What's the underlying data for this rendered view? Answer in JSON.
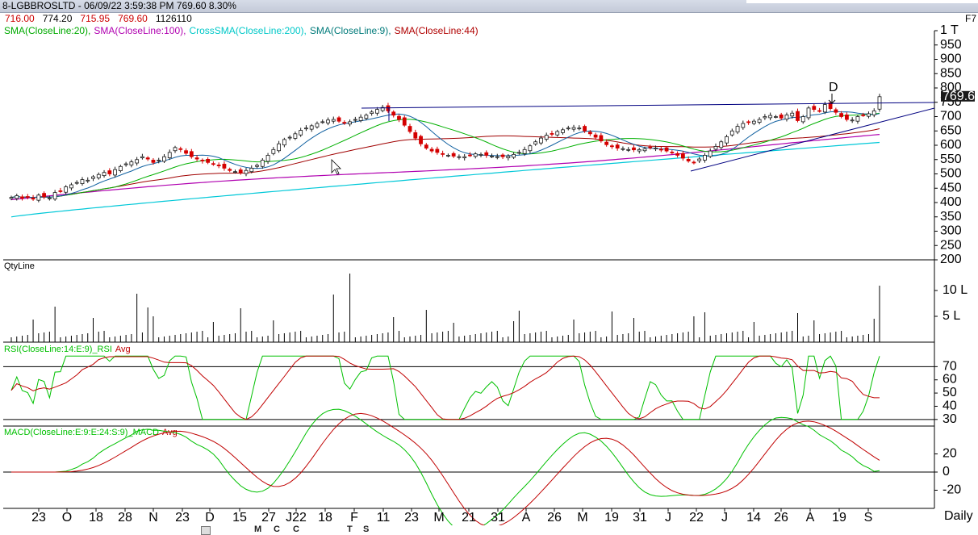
{
  "window": {
    "title": "8-LGBBROSLTD - 06/09/22 3:59:38 PM 769.60 8.30%",
    "shortcut": "F7"
  },
  "ohlc": [
    {
      "text": "716.00",
      "color": "#cc0000"
    },
    {
      "text": "774.20",
      "color": "#000000"
    },
    {
      "text": "715.95",
      "color": "#cc0000"
    },
    {
      "text": "769.60",
      "color": "#cc0000"
    },
    {
      "text": "1126110",
      "color": "#000000"
    }
  ],
  "indicators": [
    {
      "text": "SMA(CloseLine:20),",
      "color": "#00aa00"
    },
    {
      "text": "SMA(CloseLine:100),",
      "color": "#b000b0"
    },
    {
      "text": "CrossSMA(CloseLine:200),",
      "color": "#00c8c8"
    },
    {
      "text": "SMA(CloseLine:9),",
      "color": "#007a7a"
    },
    {
      "text": "SMA(CloseLine:44)",
      "color": "#b00000"
    }
  ],
  "colors": {
    "up": "#1a1a1a",
    "down": "#d40000",
    "sma20": "#00b000",
    "sma100": "#b000b0",
    "sma200": "#00c8d8",
    "sma9": "#1060a0",
    "sma44": "#a00000",
    "trend": "#000080",
    "rsi": "#00c000",
    "rsi_avg": "#c00000",
    "macd": "#00c000",
    "macd_avg": "#c00000",
    "volume": "#000000",
    "price_tag_bg": "#1a1a1a",
    "price_tag_fg": "#ffffff"
  },
  "price_tag": "769.60",
  "annotation_d": "D",
  "chart_data": [
    {
      "type": "candlestick",
      "title": "8-LGBBROSLTD",
      "xlabel": "Daily",
      "x_ticks": [
        "23",
        "O",
        "18",
        "28",
        "N",
        "23",
        "D",
        "15",
        "27",
        "J22",
        "18",
        "F",
        "11",
        "23",
        "M",
        "21",
        "31",
        "A",
        "26",
        "M",
        "19",
        "31",
        "J",
        "22",
        "J",
        "14",
        "26",
        "A",
        "19",
        "S"
      ],
      "y_ticks": [
        "1 T",
        "950",
        "900",
        "850",
        "800",
        "750",
        "700",
        "650",
        "600",
        "550",
        "500",
        "450",
        "400",
        "350",
        "300",
        "250",
        "200"
      ],
      "ylim": [
        200,
        1000
      ],
      "close": [
        418,
        424,
        415,
        420,
        412,
        426,
        420,
        416,
        435,
        440,
        455,
        462,
        470,
        480,
        478,
        490,
        498,
        505,
        500,
        515,
        526,
        535,
        542,
        550,
        560,
        552,
        540,
        548,
        560,
        575,
        592,
        585,
        572,
        560,
        552,
        545,
        540,
        535,
        528,
        520,
        512,
        508,
        505,
        512,
        520,
        530,
        548,
        565,
        585,
        605,
        620,
        628,
        640,
        652,
        660,
        668,
        676,
        682,
        688,
        690,
        684,
        678,
        682,
        690,
        698,
        705,
        716,
        725,
        732,
        720,
        705,
        690,
        670,
        648,
        625,
        605,
        590,
        580,
        575,
        568,
        565,
        562,
        560,
        560,
        565,
        570,
        568,
        565,
        562,
        560,
        560,
        562,
        568,
        575,
        585,
        598,
        612,
        625,
        635,
        640,
        648,
        654,
        660,
        662,
        660,
        650,
        640,
        628,
        615,
        602,
        595,
        590,
        588,
        585,
        584,
        585,
        588,
        592,
        590,
        585,
        580,
        575,
        565,
        555,
        545,
        540,
        552,
        565,
        580,
        596,
        612,
        630,
        650,
        666,
        676,
        680,
        684,
        690,
        700,
        704,
        700,
        695,
        706,
        712,
        686,
        700,
        730,
        725,
        720,
        742,
        728,
        715,
        700,
        690,
        688,
        700,
        705,
        710,
        720,
        769.6
      ],
      "series_levels": {
        "sma200_start": 350,
        "sma200_end": 610,
        "sma100_start": 410,
        "sma100_end": 628
      },
      "volume_lakhs": {
        "max_tick": "10 L",
        "mid_tick": "5 L"
      },
      "rsi": {
        "title": "RSI(CloseLine:14:E:9)_RSI",
        "avg": "Avg",
        "ticks": [
          "70",
          "60",
          "50",
          "40",
          "30"
        ],
        "levels": [
          70,
          30
        ]
      },
      "macd": {
        "title": "MACD(CloseLine:E:9:E:24:S:9)_MACD",
        "avg": "Avg",
        "ticks": [
          "20",
          "0",
          "-20"
        ]
      },
      "volume_title": "QtyLine"
    }
  ],
  "toolbar": {
    "items": [
      "M",
      "C",
      "C",
      "T",
      "S"
    ]
  }
}
